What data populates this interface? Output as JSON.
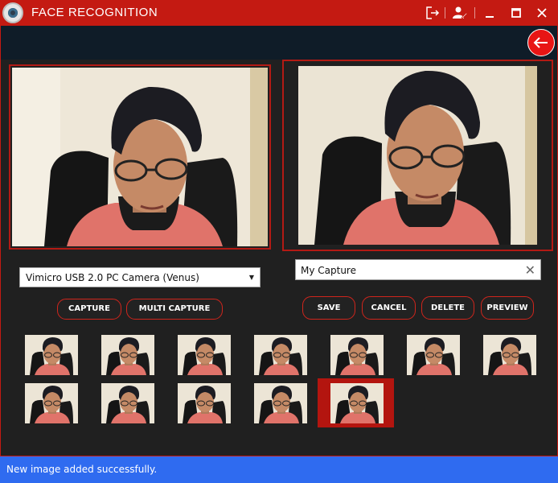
{
  "window": {
    "title": "FACE RECOGNITION"
  },
  "titlebar_icons": [
    "logout-icon",
    "user-edit-icon",
    "minimize-icon",
    "maximize-icon",
    "close-icon"
  ],
  "camera": {
    "selected": "Vimicro USB 2.0 PC Camera (Venus)"
  },
  "capture_name": {
    "value": "My Capture"
  },
  "buttons": {
    "capture": "CAPTURE",
    "multi_capture": "MULTI CAPTURE",
    "save": "SAVE",
    "cancel": "CANCEL",
    "delete": "DELETE",
    "preview": "PREVIEW"
  },
  "thumbnails": {
    "count": 12,
    "selected_index": 11
  },
  "status": {
    "message": "New image added successfully."
  },
  "colors": {
    "accent": "#c41a12",
    "status_bar": "#2f6bf0",
    "toolbar": "#0f1c28",
    "background": "#202020"
  }
}
